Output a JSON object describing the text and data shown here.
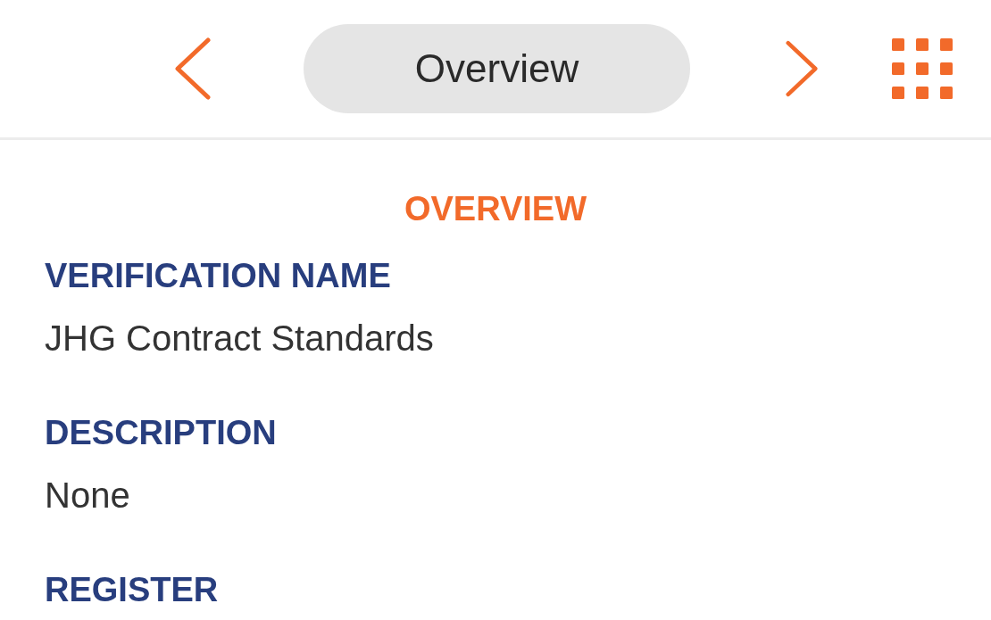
{
  "header": {
    "title": "Overview"
  },
  "section_title": "OVERVIEW",
  "fields": [
    {
      "label": "VERIFICATION NAME",
      "value": "JHG Contract Standards"
    },
    {
      "label": "DESCRIPTION",
      "value": "None"
    },
    {
      "label": "REGISTER"
    }
  ]
}
